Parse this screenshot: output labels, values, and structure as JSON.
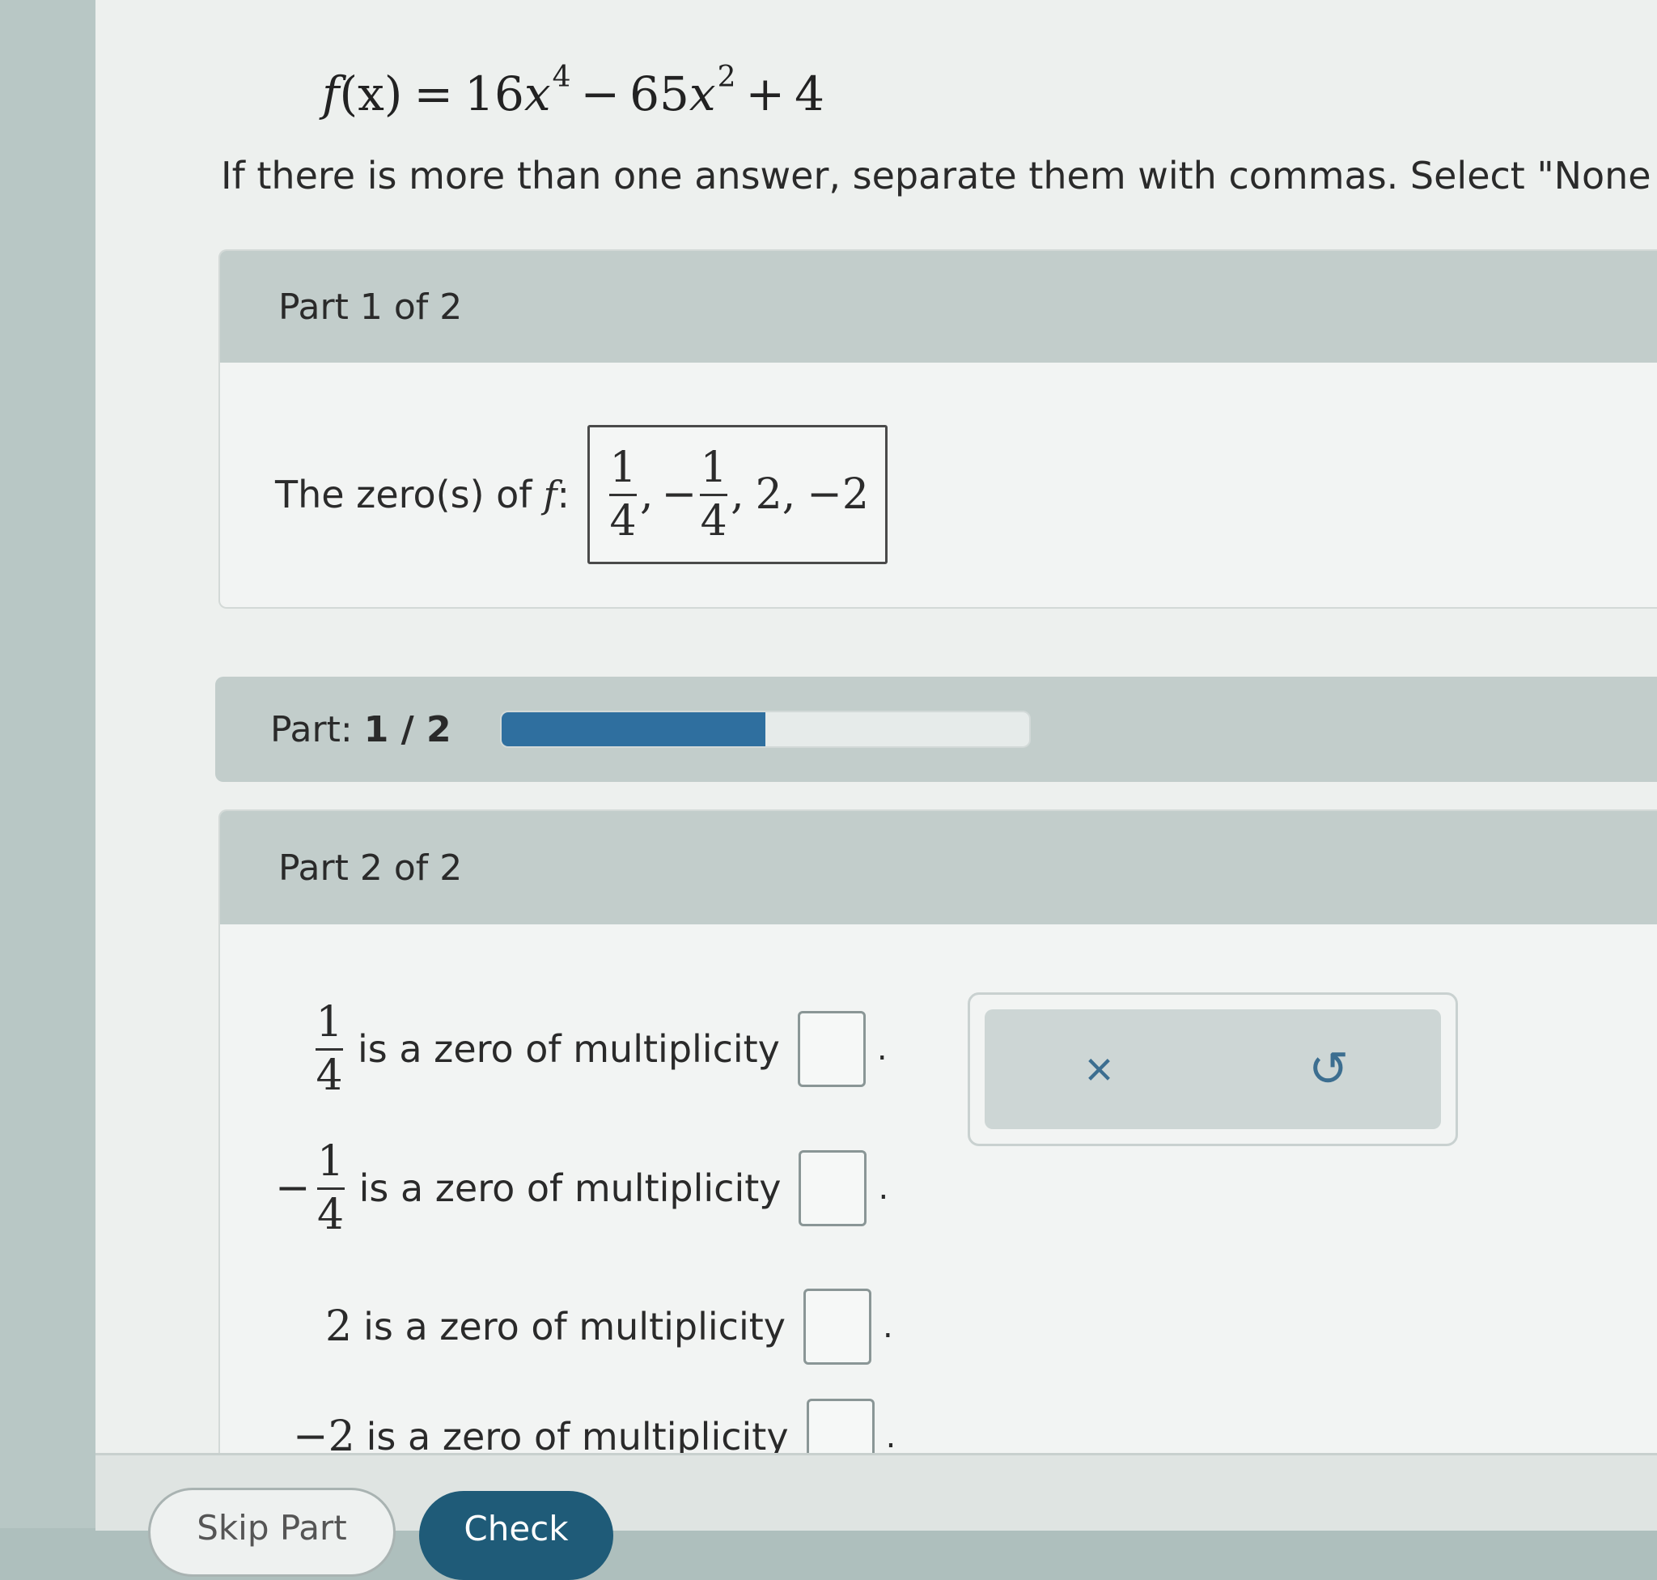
{
  "equation": {
    "lhs": "f",
    "arg": "(x)",
    "eq": "=",
    "coef1": "16",
    "var1": "x",
    "exp1": "4",
    "op1": "−",
    "coef2": "65",
    "var2": "x",
    "exp2": "2",
    "op2": "+",
    "const": "4"
  },
  "instruction": "If there is more than one answer, separate them with commas. Select \"None",
  "part1": {
    "header": "Part 1 of 2",
    "label_prefix": "The zero(s) of",
    "label_fn": "f",
    "label_colon": ":",
    "answer": {
      "z1_num": "1",
      "z1_den": "4",
      "sep1": ",",
      "z2_sign": "−",
      "z2_num": "1",
      "z2_den": "4",
      "sep2": ",",
      "z3": "2,",
      "z4": "−2"
    }
  },
  "progress": {
    "label": "Part:",
    "current": "1 / 2",
    "fraction": 0.5
  },
  "part2": {
    "header": "Part 2 of 2",
    "rows": [
      {
        "sign": "",
        "num": "1",
        "den": "4",
        "text": "is a zero of multiplicity",
        "period": "."
      },
      {
        "sign": "−",
        "num": "1",
        "den": "4",
        "text": "is a zero of multiplicity",
        "period": "."
      },
      {
        "value": "2",
        "text": "is a zero of multiplicity",
        "period": "."
      },
      {
        "value": "−2",
        "text": "is a zero of multiplicity",
        "period": "."
      }
    ]
  },
  "tools": {
    "clear_icon": "×",
    "undo_icon": "↺"
  },
  "buttons": {
    "skip": "Skip Part",
    "check": "Check"
  }
}
